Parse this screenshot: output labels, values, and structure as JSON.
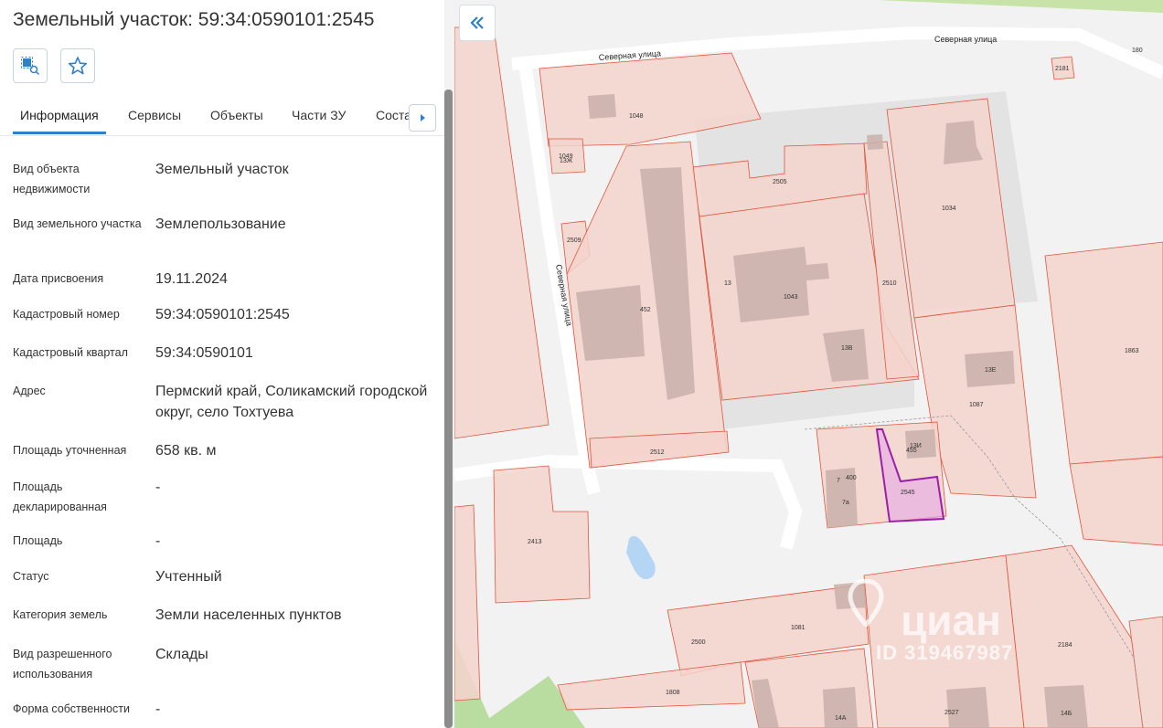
{
  "header": {
    "title": "Земельный участок: 59:34:0590101:2545"
  },
  "toolbar": {
    "icons": [
      "select-area-icon",
      "star-icon"
    ]
  },
  "tabs": [
    {
      "label": "Информация",
      "active": true
    },
    {
      "label": "Сервисы",
      "active": false
    },
    {
      "label": "Объекты",
      "active": false
    },
    {
      "label": "Части ЗУ",
      "active": false
    },
    {
      "label": "Соста",
      "active": false
    }
  ],
  "info": [
    {
      "label": "Вид объекта недвижимости",
      "value": "Земельный участок"
    },
    {
      "label": "Вид земельного участка",
      "value": "Землепользование"
    },
    {
      "label": "Дата присвоения",
      "value": "19.11.2024"
    },
    {
      "label": "Кадастровый номер",
      "value": "59:34:0590101:2545"
    },
    {
      "label": "Кадастровый квартал",
      "value": "59:34:0590101"
    },
    {
      "label": "Адрес",
      "value": "Пермский край, Соликамский городской округ, село Тохтуева"
    },
    {
      "label": "Площадь уточненная",
      "value": "658 кв. м"
    },
    {
      "label": "Площадь декларированная",
      "value": "-"
    },
    {
      "label": "Площадь",
      "value": "-"
    },
    {
      "label": "Статус",
      "value": "Учтенный"
    },
    {
      "label": "Категория земель",
      "value": "Земли населенных пунктов"
    },
    {
      "label": "Вид разрешенного использования",
      "value": "Склады"
    },
    {
      "label": "Форма собственности",
      "value": "-"
    }
  ],
  "map": {
    "streets": [
      "Северная улица",
      "Северная улица",
      "Северная улица"
    ],
    "plots": [
      "180",
      "2181",
      "1048",
      "1049",
      "2505",
      "1034",
      "2509",
      "13",
      "1043",
      "2510",
      "452",
      "13В",
      "1863",
      "13Е",
      "1087",
      "2512",
      "455",
      "400",
      "2545",
      "7а",
      "2413",
      "1081",
      "2500",
      "2184",
      "1808",
      "2527",
      "14А",
      "14Б",
      "13Ж",
      "7",
      "13И"
    ],
    "watermark": {
      "brand": "циан",
      "id": "ID 319467987"
    },
    "colors": {
      "plot_fill": "#f4d3cc",
      "plot_stroke": "#e0553c",
      "building": "#c9b0aa",
      "selected": "#9b1fa8",
      "water": "#b5d5f5"
    }
  }
}
